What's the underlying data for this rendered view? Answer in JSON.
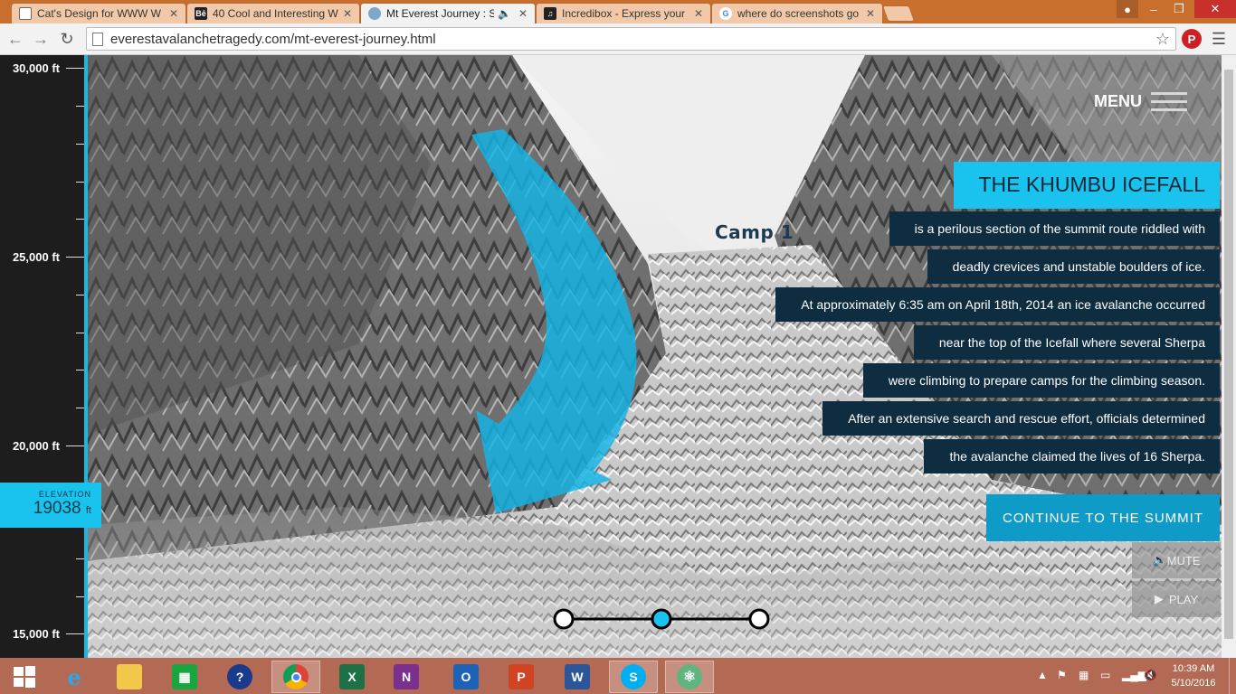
{
  "browser": {
    "tabs": [
      {
        "label": "Cat's Design for WWW W",
        "favicon": "document-icon"
      },
      {
        "label": "40 Cool and Interesting W",
        "favicon": "behance-icon"
      },
      {
        "label": "Mt Everest Journey : Sh",
        "favicon": "page-icon",
        "active": true
      },
      {
        "label": "Incredibox - Express your",
        "favicon": "incredibox-icon"
      },
      {
        "label": "where do screenshots go",
        "favicon": "google-icon"
      }
    ],
    "url": "everestavalanchetragedy.com/mt-everest-journey.html"
  },
  "ruler": {
    "labels": [
      "30,000 ft",
      "25,000 ft",
      "20,000 ft",
      "15,000 ft"
    ],
    "elevation_label": "ELEVATION",
    "elevation_value": "19038",
    "elevation_unit": "ft"
  },
  "header": {
    "menu_label": "MENU"
  },
  "scene": {
    "camp_label": "Camp 1"
  },
  "story": {
    "title": "THE KHUMBU ICEFALL",
    "lines": [
      "is a perilous section of the summit route riddled with",
      "deadly crevices and unstable boulders of ice.",
      "At approximately 6:35 am on April 18th, 2014 an ice avalanche occurred",
      "near the top of the Icefall where several Sherpa",
      "were climbing to prepare camps for the climbing season.",
      "After an extensive search and rescue effort, officials determined",
      "the avalanche claimed the lives of 16 Sherpa."
    ],
    "continue_label": "CONTINUE TO THE SUMMIT",
    "mute_label": "MUTE",
    "play_label": "PLAY"
  },
  "timeline": {
    "steps": 3,
    "active_step": 2
  },
  "taskbar": {
    "apps": [
      "start-icon",
      "ie-icon",
      "file-explorer-icon",
      "store-icon",
      "help-icon",
      "chrome-icon",
      "excel-icon",
      "onenote-icon",
      "outlook-icon",
      "powerpoint-icon",
      "word-icon",
      "skype-icon",
      "atom-icon"
    ],
    "time": "10:39 AM",
    "date": "5/10/2016"
  },
  "colors": {
    "accent": "#19c3ee",
    "panel": "#0f2d40",
    "button": "#0f9bc7"
  }
}
